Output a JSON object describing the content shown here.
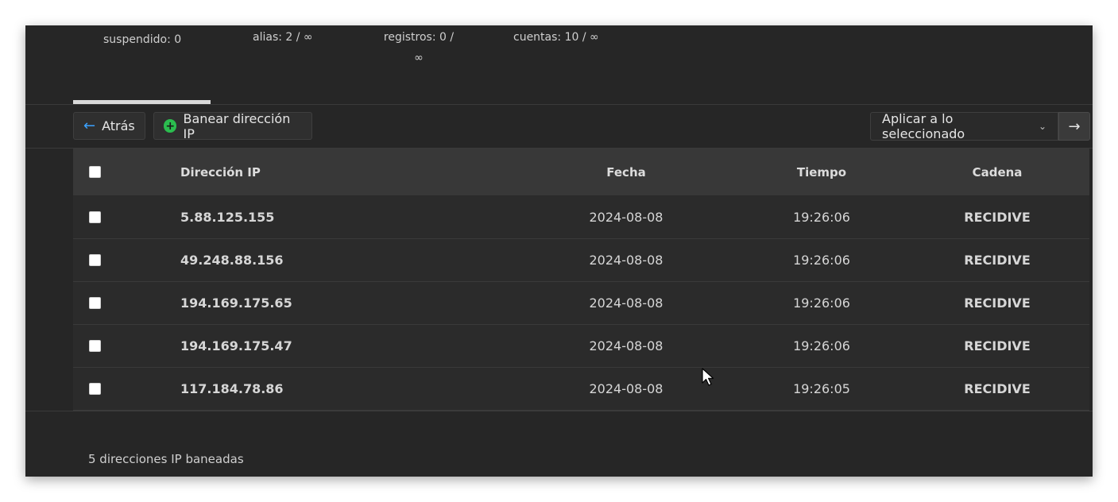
{
  "stats": {
    "suspended": "suspendido: 0",
    "alias": "alias: 2 / ∞",
    "records_line1": "registros: 0 /",
    "records_line2": "∞",
    "accounts": "cuentas: 10 / ∞"
  },
  "toolbar": {
    "back_label": "Atrás",
    "ban_label": "Banear dirección IP",
    "apply_select_value": "Aplicar a lo seleccionado",
    "go_icon": "arrow-right-icon"
  },
  "table": {
    "headers": {
      "ip": "Dirección IP",
      "date": "Fecha",
      "time": "Tiempo",
      "chain": "Cadena"
    },
    "rows": [
      {
        "ip": "5.88.125.155",
        "date": "2024-08-08",
        "time": "19:26:06",
        "chain": "RECIDIVE"
      },
      {
        "ip": "49.248.88.156",
        "date": "2024-08-08",
        "time": "19:26:06",
        "chain": "RECIDIVE"
      },
      {
        "ip": "194.169.175.65",
        "date": "2024-08-08",
        "time": "19:26:06",
        "chain": "RECIDIVE"
      },
      {
        "ip": "194.169.175.47",
        "date": "2024-08-08",
        "time": "19:26:06",
        "chain": "RECIDIVE"
      },
      {
        "ip": "117.184.78.86",
        "date": "2024-08-08",
        "time": "19:26:05",
        "chain": "RECIDIVE"
      }
    ]
  },
  "footer": {
    "count_text": "5 direcciones IP baneadas"
  },
  "colors": {
    "panel_bg": "#262626",
    "header_bg": "#383838",
    "accent_blue": "#3ba2ff",
    "accent_green": "#2bbd4f"
  }
}
